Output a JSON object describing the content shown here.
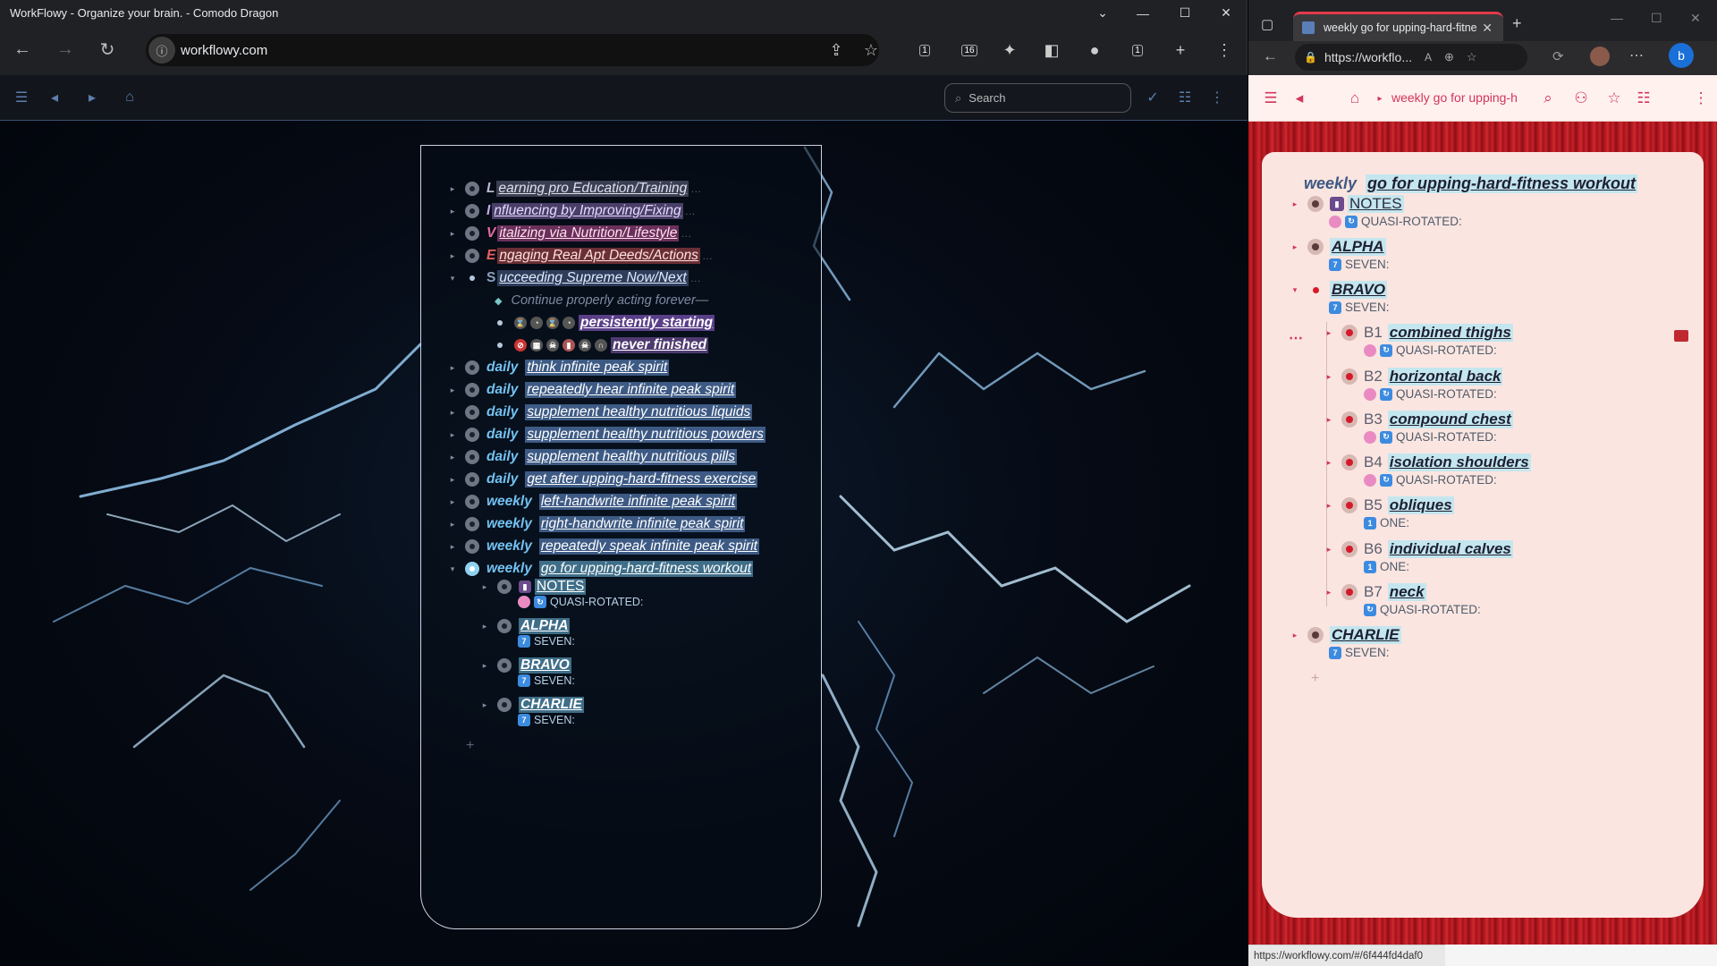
{
  "left_window": {
    "title": "WorkFlowy - Organize your brain. - Comodo Dragon",
    "url": "workflowy.com",
    "search_placeholder": "Search",
    "ext_badge_a": "1",
    "ext_badge_b": "16",
    "tab_count": "1",
    "items": [
      {
        "cap": "L",
        "text": "earning pro Education/Training",
        "color": "#b9b9cf"
      },
      {
        "cap": "I",
        "text": "nfluencing by Improving/Fixing",
        "color": "#c9a8e8"
      },
      {
        "cap": "V",
        "text": "italizing via Nutrition/Lifestyle",
        "color": "#e86b9a"
      },
      {
        "cap": "E",
        "text": "ngaging Real Apt Deeds/Actions",
        "color": "#e86060"
      },
      {
        "cap": "S",
        "text": "ucceeding Supreme Now/Next",
        "color": "#8aa0bf"
      }
    ],
    "s_children": {
      "continue": "Continue properly acting forever—",
      "persist": "persistently starting",
      "never": "never finished"
    },
    "habits": [
      {
        "tag": "daily",
        "text": "think infinite peak spirit"
      },
      {
        "tag": "daily",
        "text": "repeatedly hear infinite peak spirit"
      },
      {
        "tag": "daily",
        "text": "supplement healthy nutritious liquids"
      },
      {
        "tag": "daily",
        "text": "supplement healthy nutritious powders"
      },
      {
        "tag": "daily",
        "text": "supplement healthy nutritious pills"
      },
      {
        "tag": "daily",
        "text": "get after upping-hard-fitness exercise"
      },
      {
        "tag": "weekly",
        "text": "left-handwrite infinite peak spirit"
      },
      {
        "tag": "weekly",
        "text": "right-handwrite infinite peak spirit"
      },
      {
        "tag": "weekly",
        "text": "repeatedly speak infinite peak spirit"
      },
      {
        "tag": "weekly",
        "text": "go for upping-hard-fitness workout"
      }
    ],
    "workout_children": [
      {
        "label": "NOTES",
        "note": "QUASI-ROTATED:"
      },
      {
        "label": "ALPHA",
        "note": "SEVEN:"
      },
      {
        "label": "BRAVO",
        "note": "SEVEN:"
      },
      {
        "label": "CHARLIE",
        "note": "SEVEN:"
      }
    ]
  },
  "right_window": {
    "tab_title": "weekly go for upping-hard-fitne",
    "url": "https://workflo...",
    "crumb": "weekly go for upping-h",
    "heading_tag": "weekly",
    "heading": "go for upping-hard-fitness workout",
    "notes_label": "NOTES",
    "notes_note": "QUASI-ROTATED:",
    "alpha_label": "ALPHA",
    "alpha_note": "SEVEN:",
    "bravo_label": "BRAVO",
    "bravo_note": "SEVEN:",
    "bravo_items": [
      {
        "num": "B1",
        "name": "combined thighs",
        "note": "QUASI-ROTATED:"
      },
      {
        "num": "B2",
        "name": "horizontal back",
        "note": "QUASI-ROTATED:"
      },
      {
        "num": "B3",
        "name": "compound chest",
        "note": "QUASI-ROTATED:"
      },
      {
        "num": "B4",
        "name": "isolation shoulders",
        "note": "QUASI-ROTATED:"
      },
      {
        "num": "B5",
        "name": "obliques",
        "note": "ONE:"
      },
      {
        "num": "B6",
        "name": "individual calves",
        "note": "ONE:"
      },
      {
        "num": "B7",
        "name": "neck",
        "note": "QUASI-ROTATED:"
      }
    ],
    "charlie_label": "CHARLIE",
    "charlie_note": "SEVEN:",
    "status_url": "https://workflowy.com/#/6f444fd4daf0"
  }
}
